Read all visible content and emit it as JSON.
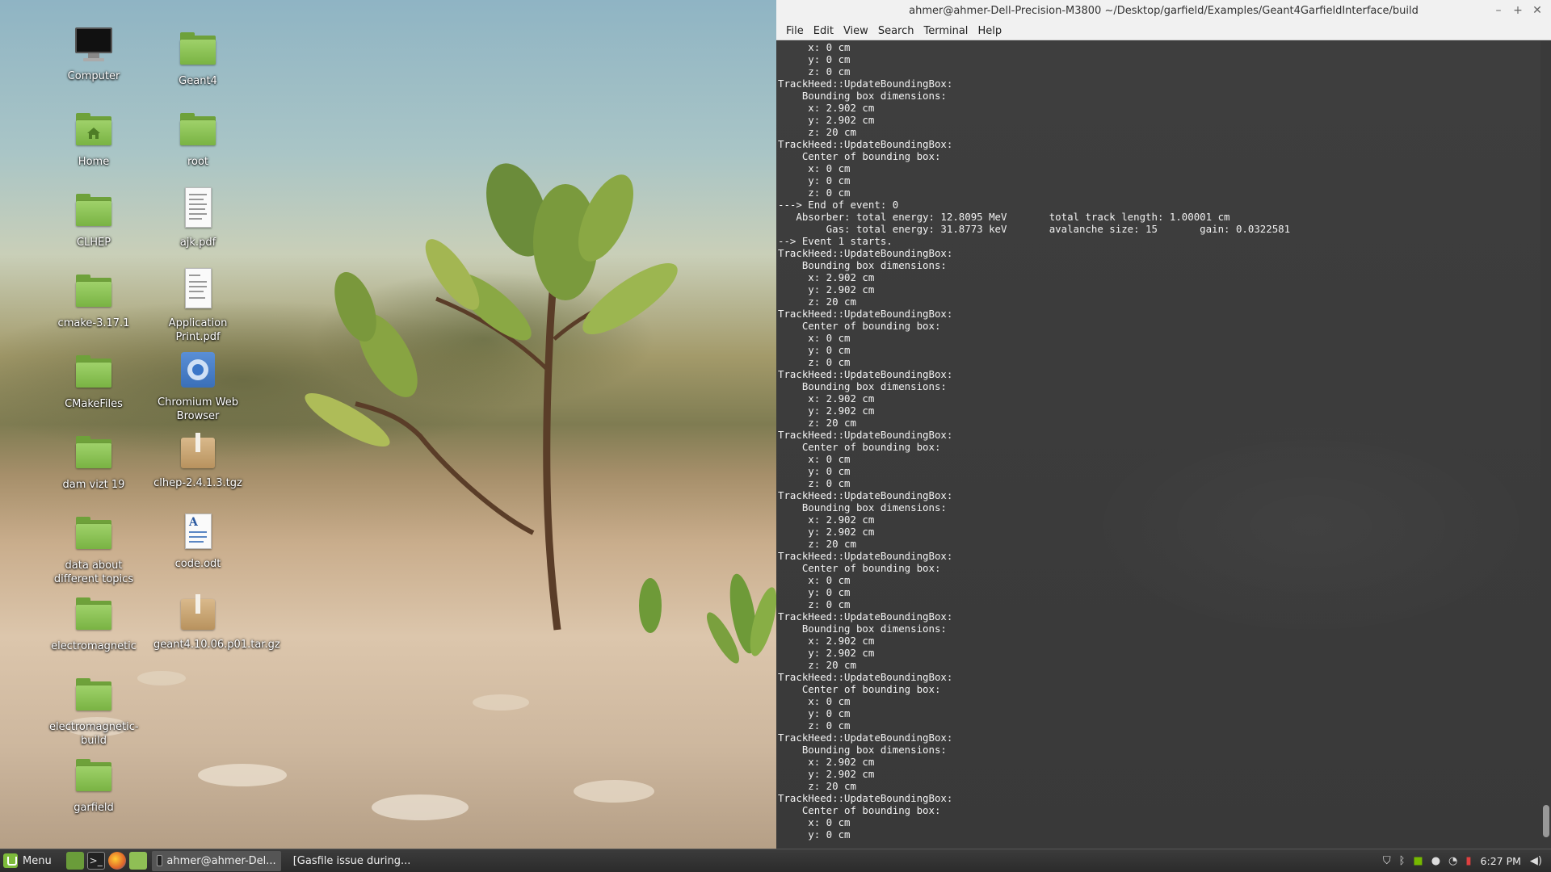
{
  "desktop": {
    "icons_col1": [
      {
        "label": "Computer",
        "type": "computer"
      },
      {
        "label": "Home",
        "type": "home"
      },
      {
        "label": "CLHEP",
        "type": "folder"
      },
      {
        "label": "cmake-3.17.1",
        "type": "folder"
      },
      {
        "label": "CMakeFiles",
        "type": "folder"
      },
      {
        "label": "dam vizt 19",
        "type": "folder"
      },
      {
        "label": "data about different topics",
        "type": "folder"
      },
      {
        "label": "electromagnetic",
        "type": "folder"
      },
      {
        "label": "electromagnetic-build",
        "type": "folder"
      },
      {
        "label": "garfield",
        "type": "folder"
      }
    ],
    "icons_col2": [
      {
        "label": "Geant4",
        "type": "folder"
      },
      {
        "label": "root",
        "type": "folder"
      },
      {
        "label": "ajk.pdf",
        "type": "pdf"
      },
      {
        "label": "Application Print.pdf",
        "type": "pdf"
      },
      {
        "label": "Chromium Web Browser",
        "type": "chromium"
      },
      {
        "label": "clhep-2.4.1.3.tgz",
        "type": "archive"
      },
      {
        "label": "code.odt",
        "type": "odt"
      },
      {
        "label": "geant4.10.06.p01.tar.gz",
        "type": "archive"
      }
    ]
  },
  "terminal": {
    "title": "ahmer@ahmer-Dell-Precision-M3800 ~/Desktop/garfield/Examples/Geant4GarfieldInterface/build",
    "controls": {
      "minimize": "–",
      "maximize": "+",
      "close": "✕"
    },
    "menu": [
      "File",
      "Edit",
      "View",
      "Search",
      "Terminal",
      "Help"
    ],
    "lines": [
      "     x: 0 cm",
      "     y: 0 cm",
      "     z: 0 cm",
      "TrackHeed::UpdateBoundingBox:",
      "    Bounding box dimensions:",
      "     x: 2.902 cm",
      "     y: 2.902 cm",
      "     z: 20 cm",
      "TrackHeed::UpdateBoundingBox:",
      "    Center of bounding box:",
      "     x: 0 cm",
      "     y: 0 cm",
      "     z: 0 cm",
      "---> End of event: 0",
      "   Absorber: total energy: 12.8095 MeV       total track length: 1.00001 cm",
      "        Gas: total energy: 31.8773 keV       avalanche size: 15       gain: 0.0322581",
      "--> Event 1 starts.",
      "TrackHeed::UpdateBoundingBox:",
      "    Bounding box dimensions:",
      "     x: 2.902 cm",
      "     y: 2.902 cm",
      "     z: 20 cm",
      "TrackHeed::UpdateBoundingBox:",
      "    Center of bounding box:",
      "     x: 0 cm",
      "     y: 0 cm",
      "     z: 0 cm",
      "TrackHeed::UpdateBoundingBox:",
      "    Bounding box dimensions:",
      "     x: 2.902 cm",
      "     y: 2.902 cm",
      "     z: 20 cm",
      "TrackHeed::UpdateBoundingBox:",
      "    Center of bounding box:",
      "     x: 0 cm",
      "     y: 0 cm",
      "     z: 0 cm",
      "TrackHeed::UpdateBoundingBox:",
      "    Bounding box dimensions:",
      "     x: 2.902 cm",
      "     y: 2.902 cm",
      "     z: 20 cm",
      "TrackHeed::UpdateBoundingBox:",
      "    Center of bounding box:",
      "     x: 0 cm",
      "     y: 0 cm",
      "     z: 0 cm",
      "TrackHeed::UpdateBoundingBox:",
      "    Bounding box dimensions:",
      "     x: 2.902 cm",
      "     y: 2.902 cm",
      "     z: 20 cm",
      "TrackHeed::UpdateBoundingBox:",
      "    Center of bounding box:",
      "     x: 0 cm",
      "     y: 0 cm",
      "     z: 0 cm",
      "TrackHeed::UpdateBoundingBox:",
      "    Bounding box dimensions:",
      "     x: 2.902 cm",
      "     y: 2.902 cm",
      "     z: 20 cm",
      "TrackHeed::UpdateBoundingBox:",
      "    Center of bounding box:",
      "     x: 0 cm",
      "     y: 0 cm"
    ]
  },
  "taskbar": {
    "menu_label": "Menu",
    "tasks": [
      {
        "label": "ahmer@ahmer-Del...",
        "active": true,
        "icon": "terminal-icon"
      },
      {
        "label": "[Gasfile issue during...",
        "active": false,
        "icon": "chromium-icon"
      }
    ],
    "clock": "6:27 PM",
    "accent": "#7dbb3b"
  }
}
